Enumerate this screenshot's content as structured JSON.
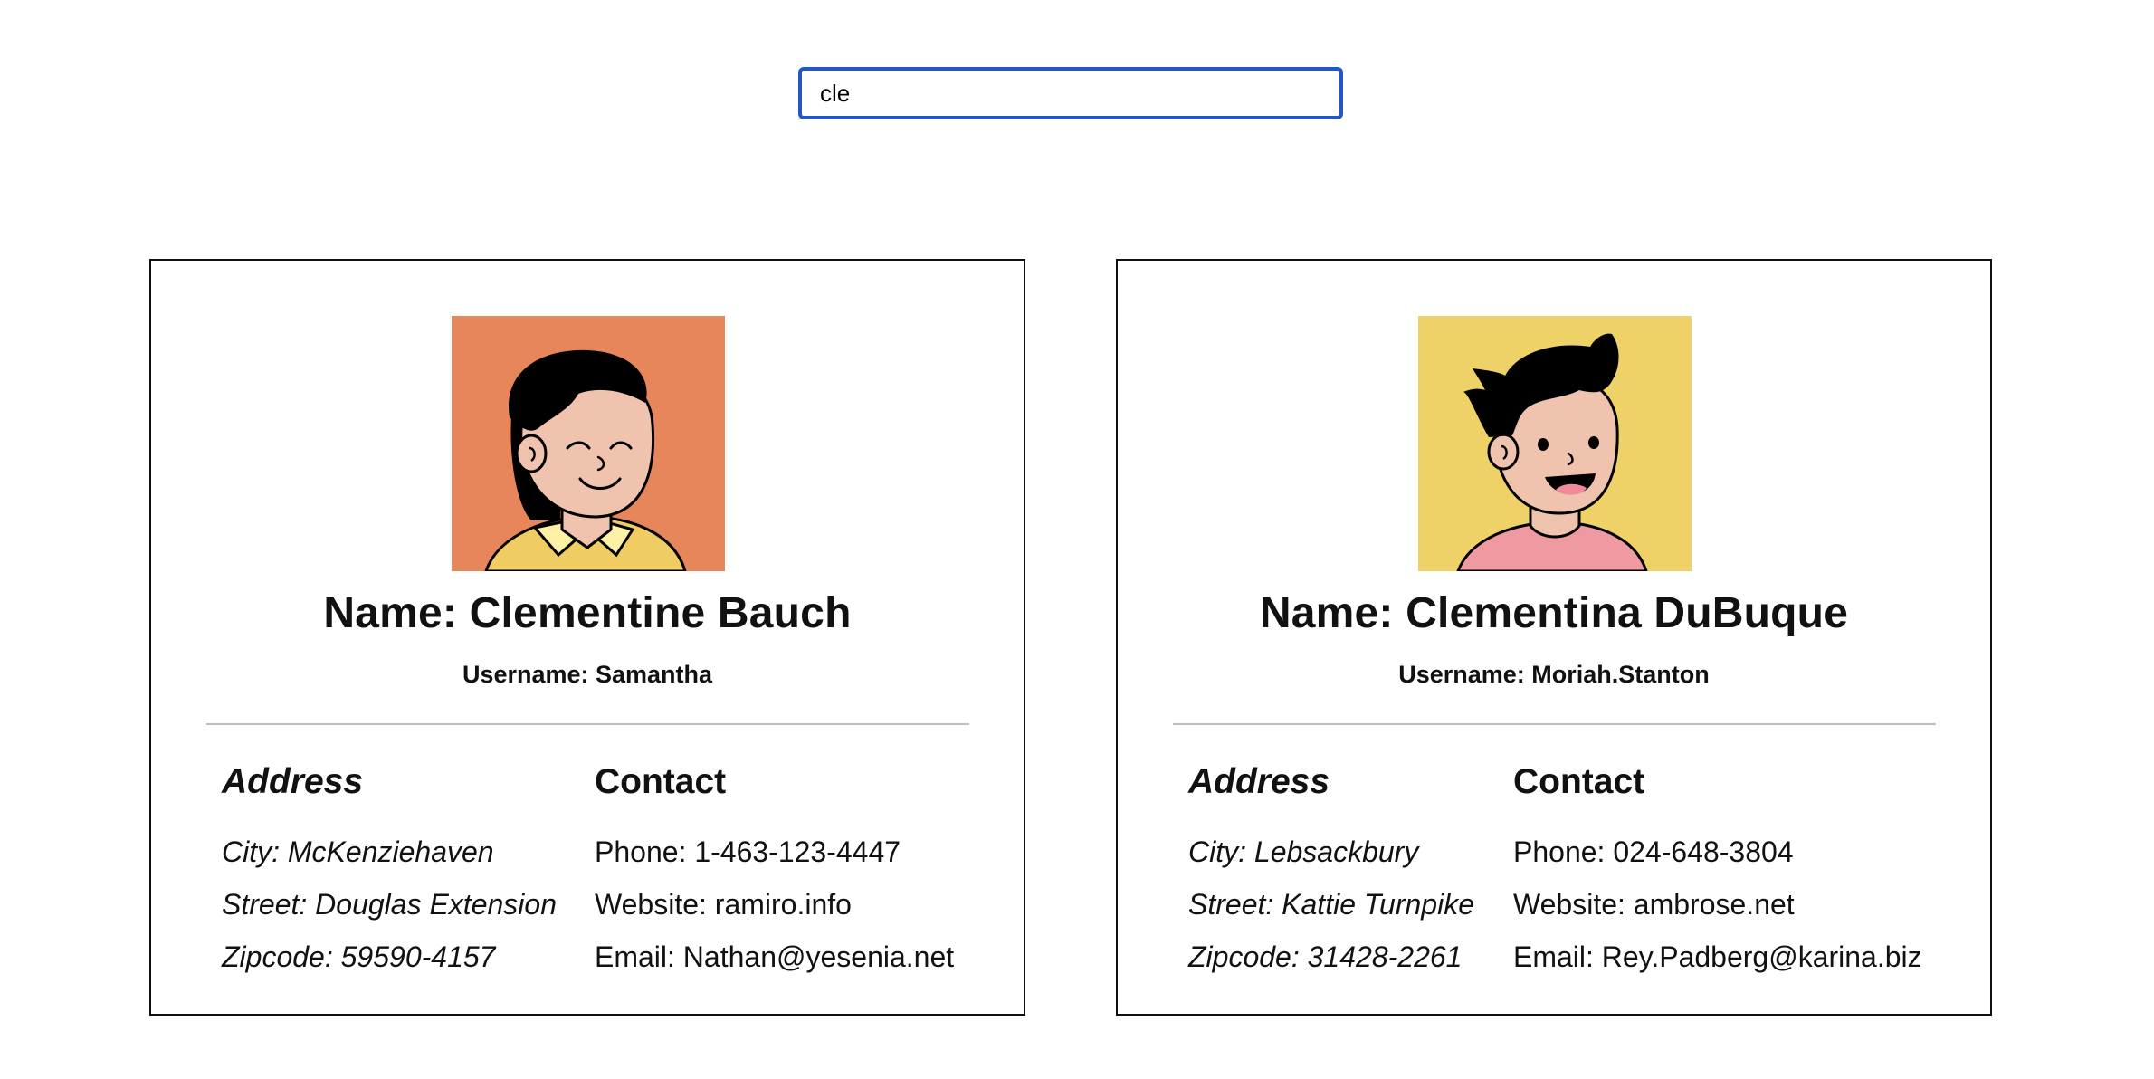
{
  "search": {
    "value": "cle"
  },
  "labels": {
    "address_heading": "Address",
    "contact_heading": "Contact"
  },
  "cards": [
    {
      "name": "Name: Clementine Bauch",
      "username": "Username: Samantha",
      "avatar_bg": "#e7865a",
      "city": "City: McKenziehaven",
      "street": "Street: Douglas Extension",
      "zipcode": "Zipcode: 59590-4157",
      "phone": "Phone: 1-463-123-4447",
      "website": "Website: ramiro.info",
      "email": "Email: Nathan@yesenia.net"
    },
    {
      "name": "Name: Clementina DuBuque",
      "username": "Username: Moriah.Stanton",
      "avatar_bg": "#eed267",
      "city": "City: Lebsackbury",
      "street": "Street: Kattie Turnpike",
      "zipcode": "Zipcode: 31428-2261",
      "phone": "Phone: 024-648-3804",
      "website": "Website: ambrose.net",
      "email": "Email: Rey.Padberg@karina.biz"
    }
  ]
}
